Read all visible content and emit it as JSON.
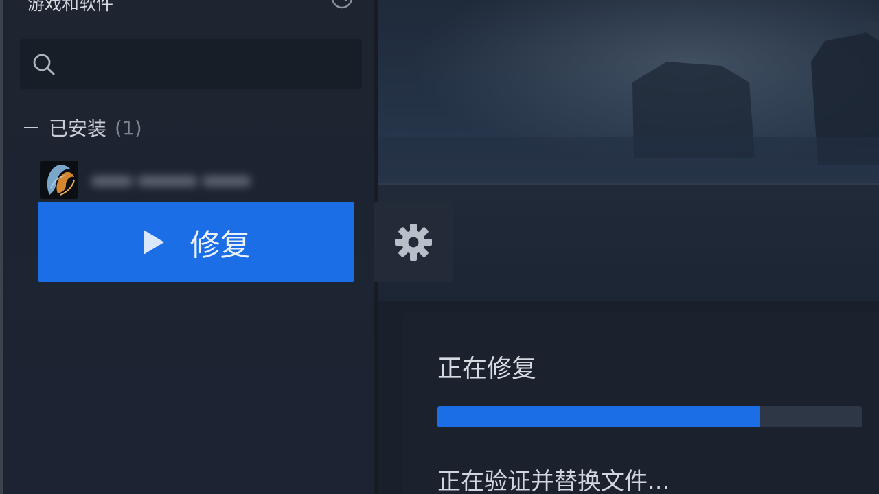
{
  "sidebar": {
    "library_title": "游戏和软件",
    "search": {
      "placeholder": "",
      "value": ""
    },
    "installed_section": {
      "label": "已安装",
      "count": "(1)"
    }
  },
  "main": {
    "play_button_label": "修复",
    "status": {
      "title": "正在修复",
      "progress_percent": 76,
      "detail": "正在验证并替换文件..."
    }
  },
  "colors": {
    "accent": "#1b6ee6",
    "sidebar_bg": "#1d2431",
    "panel_bg": "#1b222e",
    "progress_track": "#2d3746"
  },
  "icons": {
    "search": "search-icon",
    "chevron": "chevron-down-icon",
    "history": "clock-icon",
    "play": "play-triangle-icon",
    "settings": "gear-icon"
  }
}
